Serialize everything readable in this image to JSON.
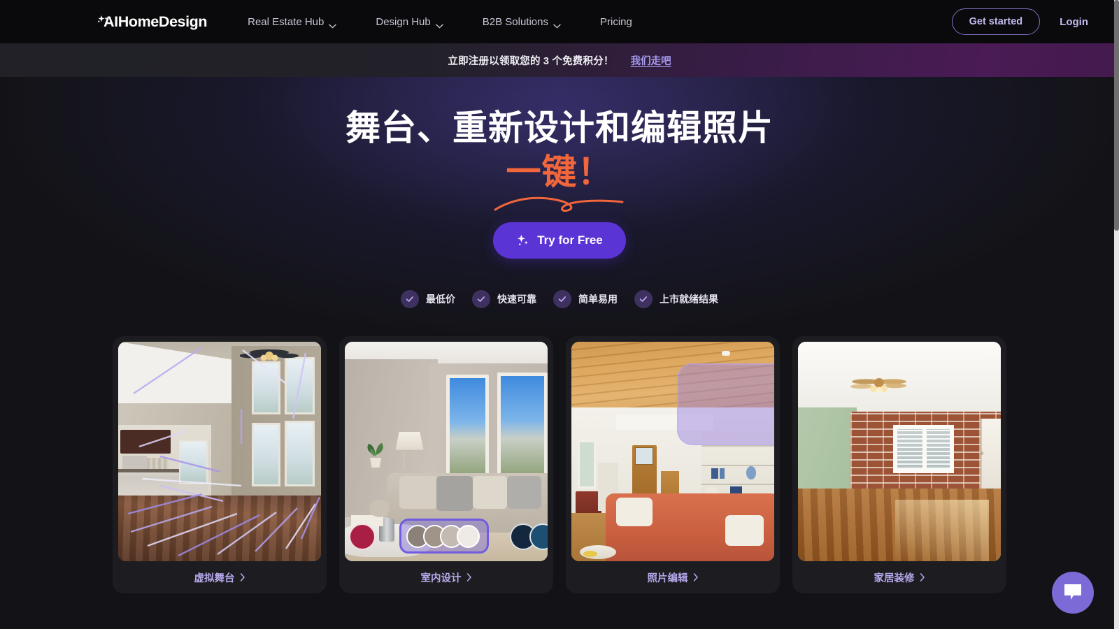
{
  "brand": {
    "logo_text_primary": "AI",
    "logo_text_secondary": "HomeDesign",
    "sparkle_icon": "sparkle-icon"
  },
  "nav": {
    "items": [
      {
        "label": "Real Estate Hub",
        "has_dropdown": true,
        "icon": "chevron-down-icon"
      },
      {
        "label": "Design Hub",
        "has_dropdown": true,
        "icon": "chevron-down-icon"
      },
      {
        "label": "B2B Solutions",
        "has_dropdown": true,
        "icon": "chevron-down-icon"
      },
      {
        "label": "Pricing",
        "has_dropdown": false,
        "icon": ""
      }
    ],
    "get_started_label": "Get started",
    "login_label": "Login"
  },
  "banner": {
    "text": "立即注册以领取您的 3 个免费积分！",
    "link_label": "我们走吧"
  },
  "hero": {
    "headline_line1": "舞台、重新设计和编辑照片",
    "headline_accent": "一键！",
    "cta_label": "Try for Free",
    "cta_icon": "sparkle-icon",
    "features": [
      {
        "label": "最低价",
        "icon": "check-icon"
      },
      {
        "label": "快速可靠",
        "icon": "check-icon"
      },
      {
        "label": "简单易用",
        "icon": "check-icon"
      },
      {
        "label": "上市就绪结果",
        "icon": "check-icon"
      }
    ]
  },
  "cards": [
    {
      "label": "虚拟舞台",
      "chevron": "chevron-right-icon"
    },
    {
      "label": "室内设计",
      "chevron": "chevron-right-icon"
    },
    {
      "label": "照片编辑",
      "chevron": "chevron-right-icon"
    },
    {
      "label": "家居装修",
      "chevron": "chevron-right-icon"
    }
  ],
  "palette": {
    "left_swatch": "#a91f43",
    "right_swatch_1": "#13283f",
    "right_swatch_2": "#1d4f73",
    "selected_swatches": [
      "#8b8178",
      "#a09387",
      "#c4bab1",
      "#efeae6"
    ]
  },
  "chat": {
    "icon": "chat-bubble-icon"
  },
  "colors": {
    "accent_purple": "#5b34d6",
    "accent_orange": "#f2663c",
    "link_purple": "#a79bf0",
    "card_bg": "#1d1d21",
    "nav_bg": "#0a0a0c",
    "chat_bg": "#7c6bd6"
  }
}
